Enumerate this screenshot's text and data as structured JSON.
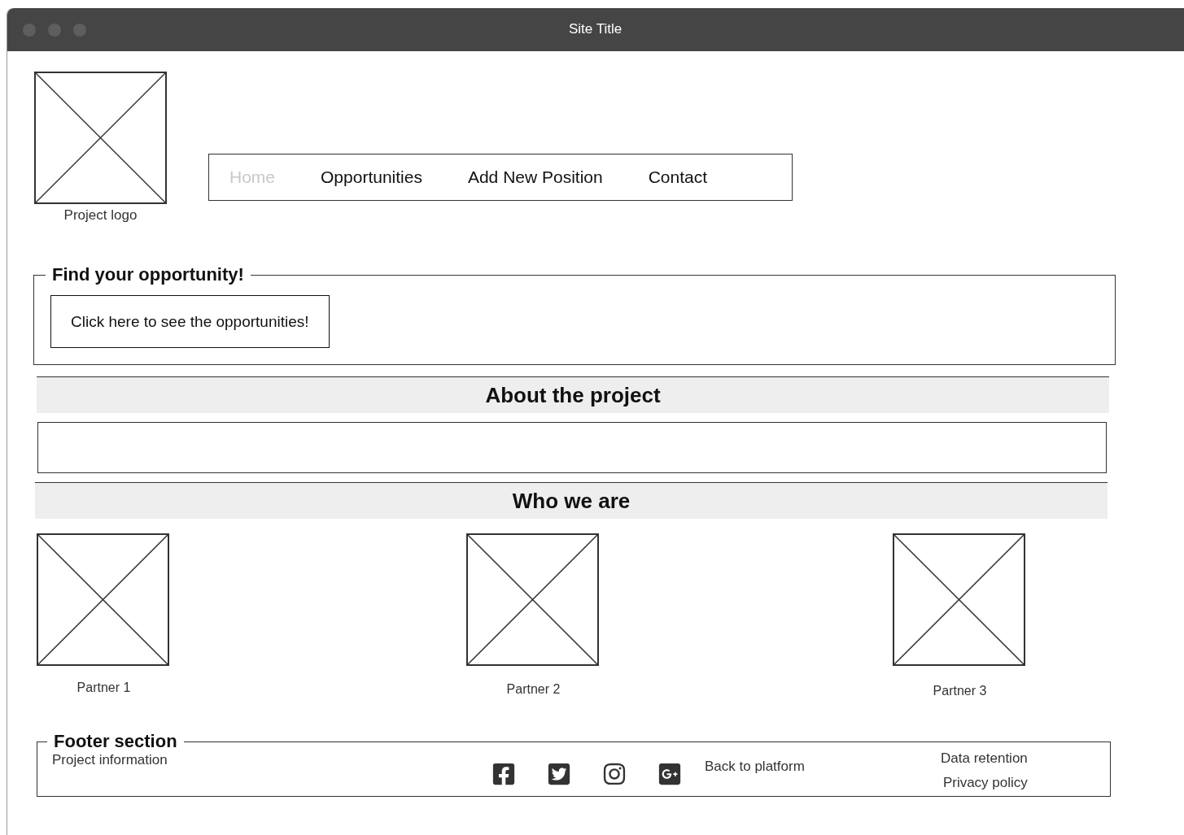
{
  "window": {
    "title": "Site Title"
  },
  "logo": {
    "caption": "Project logo"
  },
  "nav": [
    {
      "label": "Home",
      "selected": true
    },
    {
      "label": "Opportunities",
      "selected": false
    },
    {
      "label": "Add New Position",
      "selected": false
    },
    {
      "label": "Contact",
      "selected": false
    }
  ],
  "find_section": {
    "title": "Find your opportunity!",
    "button": "Click here to see the opportunities!"
  },
  "about": {
    "heading": "About the project"
  },
  "who": {
    "heading": "Who we are",
    "partners": [
      {
        "caption": "Partner 1"
      },
      {
        "caption": "Partner 2"
      },
      {
        "caption": "Partner 3"
      }
    ]
  },
  "footer": {
    "title": "Footer section",
    "info": "Project information",
    "social": [
      {
        "kind": "facebook"
      },
      {
        "kind": "twitter"
      },
      {
        "kind": "instagram"
      },
      {
        "kind": "googleplus"
      }
    ],
    "back_link": "Back to platform",
    "links": [
      "Data retention",
      "Privacy policy"
    ]
  }
}
